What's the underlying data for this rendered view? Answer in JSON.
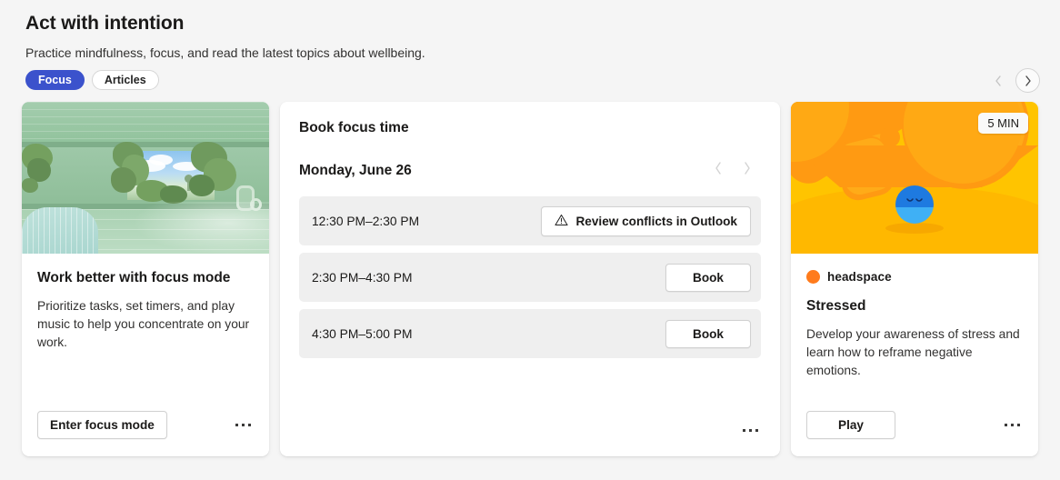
{
  "header": {
    "title": "Act with intention",
    "subtitle": "Practice mindfulness, focus, and read the latest topics about wellbeing.",
    "tabs": [
      {
        "label": "Focus",
        "active": true
      },
      {
        "label": "Articles",
        "active": false
      }
    ],
    "carousel": {
      "prev_label": "Previous",
      "prev_enabled": false,
      "next_label": "Next",
      "next_enabled": true
    }
  },
  "accent_color": "#3b52cc",
  "cards": {
    "focus_mode": {
      "hero_alt": "green-interior-illustration",
      "title": "Work better with focus mode",
      "description": "Prioritize tasks, set timers, and play music to help you concentrate on your work.",
      "primary_button": "Enter focus mode",
      "more_label": "More options"
    },
    "book_focus_time": {
      "title": "Book focus time",
      "date": "Monday, June 26",
      "prev_day_label": "Previous day",
      "next_day_label": "Next day",
      "slots": [
        {
          "time": "12:30 PM–2:30 PM",
          "action": "Review conflicts in Outlook",
          "has_warning": true
        },
        {
          "time": "2:30 PM–4:30 PM",
          "action": "Book",
          "has_warning": false
        },
        {
          "time": "4:30 PM–5:00 PM",
          "action": "Book",
          "has_warning": false
        }
      ],
      "more_label": "More options"
    },
    "headspace": {
      "hero_alt": "headspace-orange-illustration",
      "duration_badge": "5 MIN",
      "brand": "headspace",
      "brand_color": "#ff7b1c",
      "title": "Stressed",
      "description": "Develop your awareness of stress and learn how to reframe negative emotions.",
      "primary_button": "Play",
      "more_label": "More options"
    }
  }
}
